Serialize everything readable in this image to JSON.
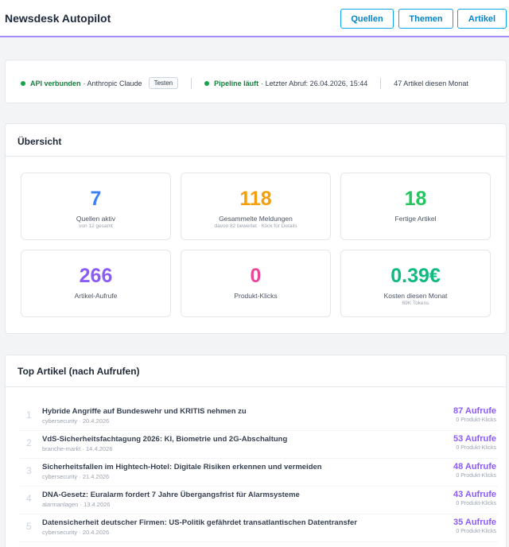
{
  "header": {
    "title": "Newsdesk Autopilot",
    "nav": [
      "Quellen",
      "Themen",
      "Artikel"
    ]
  },
  "status": {
    "api_label": "API verbunden",
    "api_detail": "· Anthropic Claude",
    "test_button": "Testen",
    "pipeline_label": "Pipeline läuft",
    "pipeline_detail": "· Letzter Abruf: 26.04.2026, 15:44",
    "articles_month": "47 Artikel diesen Monat",
    "ok_color": "#16a34a"
  },
  "overview": {
    "title": "Übersicht",
    "stats": [
      {
        "value": "7",
        "label": "Quellen aktiv",
        "sub": "von 12 gesamt",
        "color": "#3b82f6"
      },
      {
        "value": "118",
        "label": "Gesammelte Meldungen",
        "sub": "davon 82 bewertet · Klick für Details",
        "color": "#f59e0b"
      },
      {
        "value": "18",
        "label": "Fertige Artikel",
        "sub": "",
        "color": "#22c55e"
      },
      {
        "value": "266",
        "label": "Artikel-Aufrufe",
        "sub": "",
        "color": "#8b5cf6"
      },
      {
        "value": "0",
        "label": "Produkt-Klicks",
        "sub": "",
        "color": "#ec4899"
      },
      {
        "value": "0.39€",
        "label": "Kosten diesen Monat",
        "sub": "69K Tokens",
        "color": "#10b981"
      }
    ]
  },
  "top": {
    "title": "Top Artikel (nach Aufrufen)",
    "rows": [
      {
        "rank": "1",
        "title": "Hybride Angriffe auf Bundeswehr und KRITIS nehmen zu",
        "meta": "cybersecurity · 20.4.2026",
        "views": "87 Aufrufe",
        "clicks": "0 Produkt-Klicks"
      },
      {
        "rank": "2",
        "title": "VdS-Sicherheitsfachtagung 2026: KI, Biometrie und 2G-Abschaltung",
        "meta": "branche-markt · 14.4.2026",
        "views": "53 Aufrufe",
        "clicks": "0 Produkt-Klicks"
      },
      {
        "rank": "3",
        "title": "Sicherheitsfallen im Hightech-Hotel: Digitale Risiken erkennen und vermeiden",
        "meta": "cybersecurity · 21.4.2026",
        "views": "48 Aufrufe",
        "clicks": "0 Produkt-Klicks"
      },
      {
        "rank": "4",
        "title": "DNA-Gesetz: Euralarm fordert 7 Jahre Übergangsfrist für Alarmsysteme",
        "meta": "alarmanlagen · 13.4.2026",
        "views": "43 Aufrufe",
        "clicks": "0 Produkt-Klicks"
      },
      {
        "rank": "5",
        "title": "Datensicherheit deutscher Firmen: US-Politik gefährdet transatlantischen Datentransfer",
        "meta": "cybersecurity · 20.4.2026",
        "views": "35 Aufrufe",
        "clicks": "0 Produkt-Klicks"
      }
    ]
  }
}
